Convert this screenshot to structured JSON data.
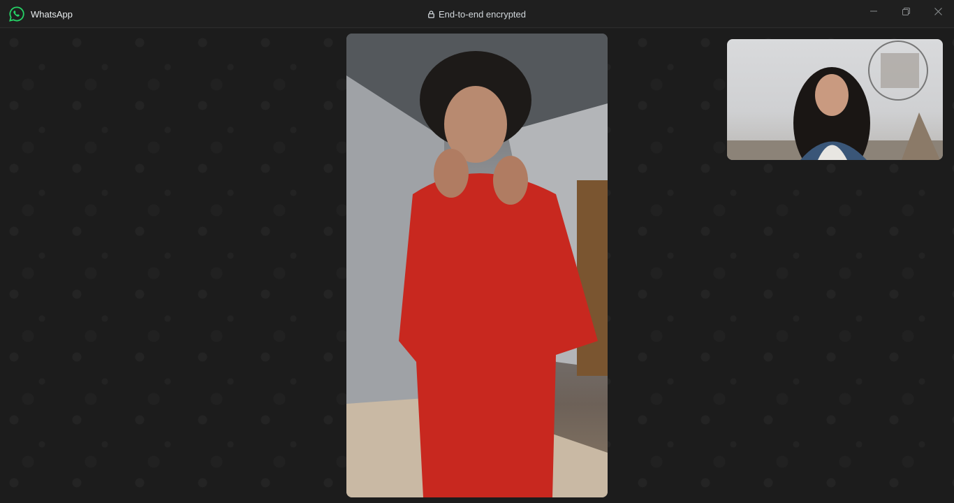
{
  "app": {
    "title": "WhatsApp",
    "brand_color": "#25d366"
  },
  "header": {
    "encryption_text": "End-to-end encrypted",
    "lock_icon": "lock-icon"
  },
  "window_controls": {
    "minimize_icon": "minimize-icon",
    "maximize_icon": "restore-icon",
    "close_icon": "close-icon"
  },
  "call": {
    "remote_name": "",
    "remote_video": "remote-participant-video",
    "self_video": "self-view-video"
  }
}
